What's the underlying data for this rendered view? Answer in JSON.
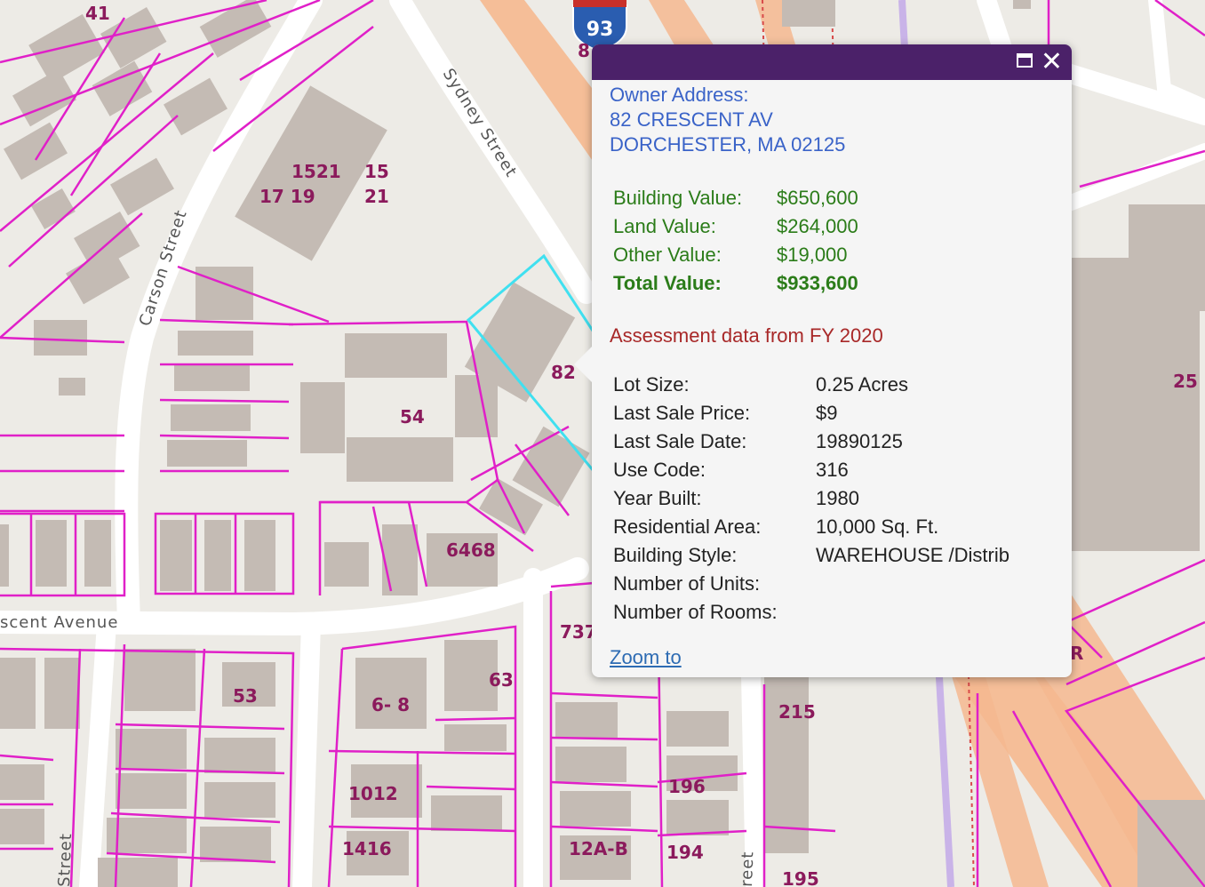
{
  "map": {
    "highway_shield": "93",
    "streets": [
      "Sydney Street",
      "Carson Street",
      "scent Avenue",
      "Street",
      "reet"
    ],
    "parcel_labels": [
      "41",
      "1521",
      "15",
      "17 19",
      "21",
      "82",
      "54",
      "25",
      "6468",
      "737",
      "53",
      "6- 8",
      "63",
      "215",
      "1012",
      "196",
      "1416",
      "12A-B",
      "194",
      "195",
      "R",
      "8"
    ],
    "colors": {
      "parcel_line": "#e020c8",
      "selected_parcel": "#40e0f0",
      "building": "#c4bbb4",
      "road": "#ffffff",
      "highway": "#f5b98f",
      "background": "#edebe6"
    }
  },
  "popup": {
    "title_bar_color": "#4b2169",
    "controls": {
      "maximize_icon": "maximize-icon",
      "close_icon": "close-icon"
    },
    "owner_address_label": "Owner Address:",
    "owner_address_line1": "82 CRESCENT AV",
    "owner_address_line2": "DORCHESTER, MA 02125",
    "values": [
      {
        "label": "Building Value:",
        "value": "$650,600"
      },
      {
        "label": "Land Value:",
        "value": "$264,000"
      },
      {
        "label": "Other Value:",
        "value": "$19,000"
      },
      {
        "label": "Total Value:",
        "value": "$933,600"
      }
    ],
    "assessment_note": "Assessment data from FY 2020",
    "attributes": [
      {
        "label": "Lot Size:",
        "value": "0.25 Acres"
      },
      {
        "label": "Last Sale Price:",
        "value": "$9"
      },
      {
        "label": "Last Sale Date:",
        "value": "19890125"
      },
      {
        "label": "Use Code:",
        "value": "316"
      },
      {
        "label": "Year Built:",
        "value": "1980"
      },
      {
        "label": "Residential Area:",
        "value": "10,000 Sq. Ft."
      },
      {
        "label": "Building Style:",
        "value": "WAREHOUSE /Distrib"
      },
      {
        "label": "Number of Units:",
        "value": ""
      },
      {
        "label": "Number of Rooms:",
        "value": ""
      }
    ],
    "zoom_link": "Zoom to"
  }
}
